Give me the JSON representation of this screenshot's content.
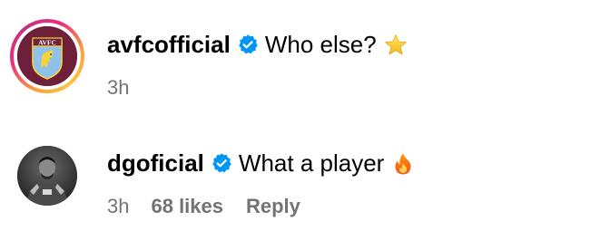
{
  "comments": [
    {
      "username": "avfcofficial",
      "verified": true,
      "text": "Who else?",
      "emoji": "star-emoji",
      "time": "3h",
      "crest_label": "AVFC",
      "colors": {
        "crest_bg": "#6e1f3a",
        "crest_shield": "#8fc2ea",
        "crest_lion": "#f5d437"
      }
    },
    {
      "username": "dgoficial",
      "verified": true,
      "text": "What a player",
      "emoji": "fire-emoji",
      "time": "3h",
      "likes": "68 likes",
      "reply": "Reply"
    }
  ],
  "colors": {
    "text": "#000000",
    "meta": "#737373",
    "verified_badge": "#0095f6"
  }
}
